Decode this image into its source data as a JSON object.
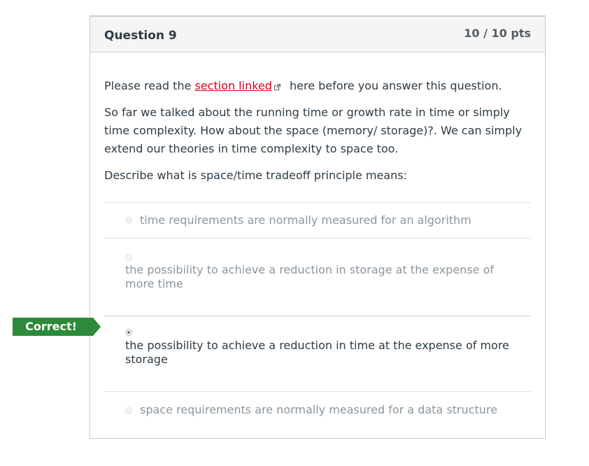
{
  "question": {
    "title": "Question 9",
    "points": "10 / 10 pts",
    "intro_before": "Please read the ",
    "link_text": "section linked",
    "intro_after": " here before you answer this question.",
    "paragraph": "So far we talked about the running time or growth rate in time or simply time complexity. How about the space (memory/ storage)?. We can simply extend our theories in time complexity to space too.",
    "prompt": "Describe what is space/time tradeoff principle means:"
  },
  "answers": [
    {
      "text": "time requirements are normally measured for an algorithm",
      "selected": false
    },
    {
      "text": "the possibility to achieve a reduction in storage at the expense of more time",
      "selected": false
    },
    {
      "text": "the possibility to achieve a reduction in time at the expense of more storage",
      "selected": true
    },
    {
      "text": "space requirements are normally measured for a data structure",
      "selected": false
    }
  ],
  "result_flag": "Correct!",
  "colors": {
    "link": "#d0021b",
    "correct_flag": "#2d8a3a"
  },
  "icons": {
    "external_link": "external-link-icon"
  }
}
